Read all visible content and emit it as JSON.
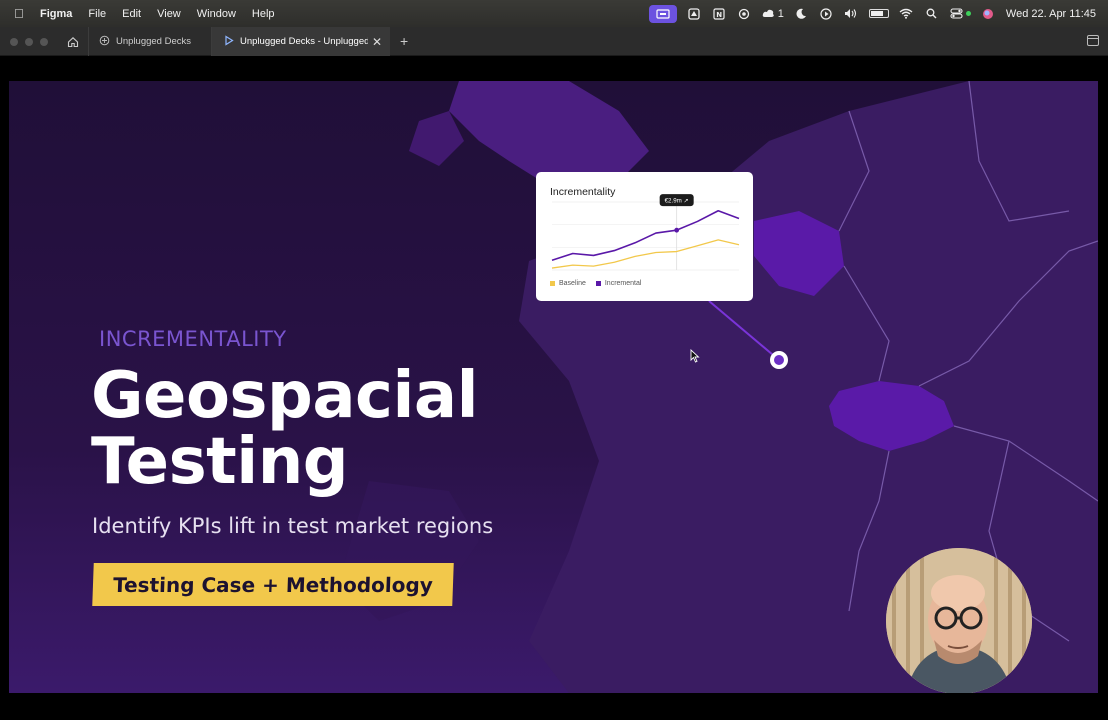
{
  "menubar": {
    "app_name": "Figma",
    "menus": [
      "File",
      "Edit",
      "View",
      "Window",
      "Help"
    ],
    "notification_count": "1",
    "clock": "Wed 22. Apr  11:45"
  },
  "tabs": [
    {
      "label": "Unplugged Decks"
    },
    {
      "label": "Unplugged Decks - Unplugged A"
    }
  ],
  "slide": {
    "eyebrow": "INCREMENTALITY",
    "title_line1": "Geospacial",
    "title_line2": "Testing",
    "subtitle": "Identify KPIs lift in test market regions",
    "cta": "Testing Case + Methodology"
  },
  "chart_card": {
    "title": "Incrementality",
    "tooltip": "€2.9m ↗",
    "legend": [
      "Baseline",
      "Incremental"
    ]
  },
  "chart_data": {
    "type": "line",
    "title": "Incrementality",
    "x": [
      1,
      2,
      3,
      4,
      5,
      6,
      7,
      8,
      9,
      10
    ],
    "series": [
      {
        "name": "Baseline",
        "color": "#f2c84b",
        "values": [
          2,
          5,
          4,
          8,
          14,
          18,
          19,
          25,
          31,
          26
        ]
      },
      {
        "name": "Incremental",
        "color": "#5a18a8",
        "values": [
          10,
          17,
          15,
          20,
          28,
          38,
          41,
          50,
          61,
          53
        ]
      }
    ],
    "highlight": {
      "index": 6,
      "label": "€2.9m ↗"
    },
    "ylim": [
      0,
      70
    ],
    "grid": true,
    "legend_position": "bottom-left"
  },
  "colors": {
    "accent": "#6b2fc4",
    "cta": "#f2c84b",
    "eyebrow": "#7a55d0",
    "menu_active": "#6c52e0"
  }
}
